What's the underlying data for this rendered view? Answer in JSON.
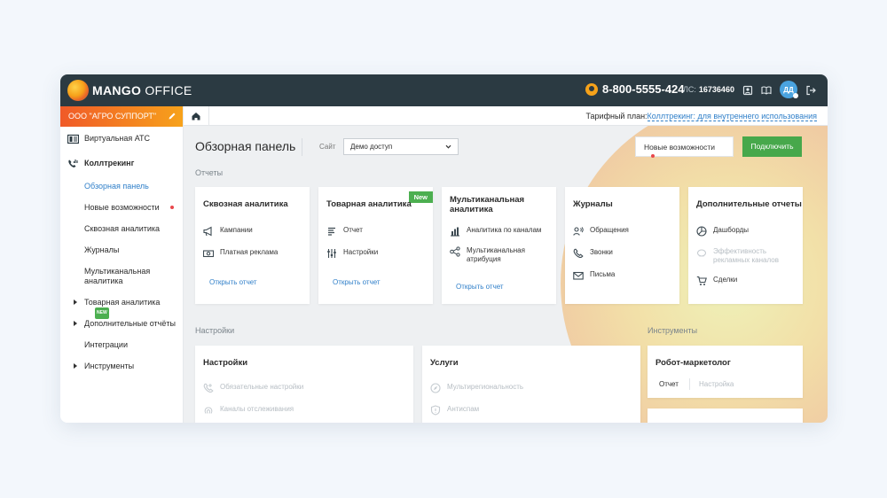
{
  "topbar": {
    "logo_bold": "MANGO",
    "logo_light": " OFFICE",
    "phone": "8-800-5555-424",
    "account_label": "ЛС:",
    "account_number": "16736460",
    "avatar_initials": "ДД"
  },
  "sidebar": {
    "company": "ООО \"АГРО СУППОРТ\"",
    "items": [
      {
        "label": "Виртуальная АТС"
      },
      {
        "label": "Коллтрекинг"
      },
      {
        "label": "Обзорная панель"
      },
      {
        "label": "Новые возможности"
      },
      {
        "label": "Сквозная аналитика"
      },
      {
        "label": "Журналы"
      },
      {
        "label": "Мультиканальная аналитика"
      },
      {
        "label": "Товарная аналитика",
        "badge": "NEW"
      },
      {
        "label": "Дополнительные отчёты"
      },
      {
        "label": "Интеграции"
      },
      {
        "label": "Инструменты"
      }
    ]
  },
  "subbar": {
    "tariff_label": "Тарифный план:",
    "tariff_value": "Коллтрекинг: для внутреннего использования"
  },
  "header": {
    "title": "Обзорная панель",
    "site_label": "Сайт",
    "site_value": "Демо доступ",
    "new_features": "Новые возможности",
    "connect": "Подключить"
  },
  "sections": {
    "reports": "Отчеты",
    "settings": "Настройки",
    "tools": "Инструменты"
  },
  "report_cards": [
    {
      "title": "Сквозная аналитика",
      "items": [
        "Кампании",
        "Платная реклама"
      ],
      "link": "Открыть отчет"
    },
    {
      "title": "Товарная аналитика",
      "badge": "New",
      "items": [
        "Отчет",
        "Настройки"
      ],
      "link": "Открыть отчет"
    },
    {
      "title": "Мультиканальная аналитика",
      "items": [
        "Аналитика по каналам",
        "Мультиканальная атрибуция"
      ],
      "link": "Открыть отчет"
    },
    {
      "title": "Журналы",
      "items": [
        "Обращения",
        "Звонки",
        "Письма"
      ]
    },
    {
      "title": "Дополнительные отчеты",
      "items": [
        "Дашборды",
        "Эффективность рекламных каналов",
        "Сделки"
      ]
    }
  ],
  "settings_cards": [
    {
      "title": "Настройки",
      "items": [
        "Обязательные настройки",
        "Каналы отслеживания"
      ]
    },
    {
      "title": "Услуги",
      "items": [
        "Мультирегиональность",
        "Антиспам"
      ]
    }
  ],
  "tool_cards": [
    {
      "title": "Робот-маркетолог",
      "tabs": [
        "Отчет",
        "Настройка"
      ]
    }
  ],
  "colors": {
    "topbar": "#2b3a42",
    "accent_blue": "#2f7fc9",
    "connect_green": "#47a84b",
    "company_orange": "#f05a28"
  }
}
